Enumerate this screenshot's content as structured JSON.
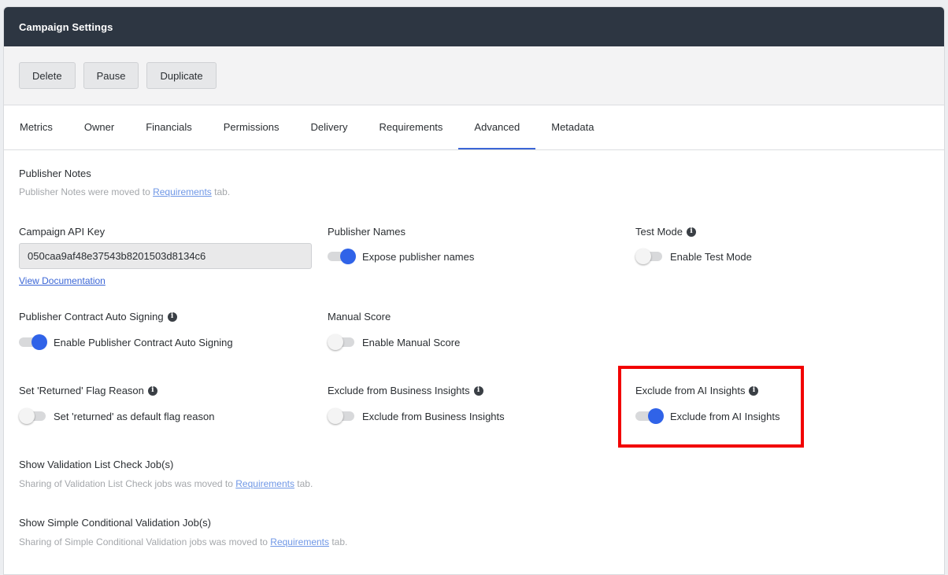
{
  "header": {
    "title": "Campaign Settings"
  },
  "actions": {
    "delete": "Delete",
    "pause": "Pause",
    "duplicate": "Duplicate"
  },
  "tabs": [
    {
      "label": "Metrics"
    },
    {
      "label": "Owner"
    },
    {
      "label": "Financials"
    },
    {
      "label": "Permissions"
    },
    {
      "label": "Delivery"
    },
    {
      "label": "Requirements"
    },
    {
      "label": "Advanced"
    },
    {
      "label": "Metadata"
    }
  ],
  "active_tab": "Advanced",
  "publisher_notes": {
    "title": "Publisher Notes",
    "text_before": "Publisher Notes were moved to ",
    "link": "Requirements",
    "text_after": " tab."
  },
  "api_key": {
    "title": "Campaign API Key",
    "value": "050caa9af48e37543b8201503d8134c6",
    "doc_link": "View Documentation"
  },
  "publisher_names": {
    "title": "Publisher Names",
    "toggle_label": "Expose publisher names",
    "on": true
  },
  "test_mode": {
    "title": "Test Mode",
    "toggle_label": "Enable Test Mode",
    "on": false
  },
  "auto_signing": {
    "title": "Publisher Contract Auto Signing",
    "toggle_label": "Enable Publisher Contract Auto Signing",
    "on": true
  },
  "manual_score": {
    "title": "Manual Score",
    "toggle_label": "Enable Manual Score",
    "on": false
  },
  "returned_flag": {
    "title": "Set 'Returned' Flag Reason",
    "toggle_label": "Set 'returned' as default flag reason",
    "on": false
  },
  "business_insights": {
    "title": "Exclude from Business Insights",
    "toggle_label": "Exclude from Business Insights",
    "on": false
  },
  "ai_insights": {
    "title": "Exclude from AI Insights",
    "toggle_label": "Exclude from AI Insights",
    "on": true
  },
  "validation_list": {
    "title": "Show Validation List Check Job(s)",
    "text_before": "Sharing of Validation List Check jobs was moved to ",
    "link": "Requirements",
    "text_after": " tab."
  },
  "conditional_validation": {
    "title": "Show Simple Conditional Validation Job(s)",
    "text_before": "Sharing of Simple Conditional Validation jobs was moved to ",
    "link": "Requirements",
    "text_after": " tab."
  },
  "colors": {
    "header_bg": "#2d3642",
    "accent": "#3063e8",
    "highlight": "#f20000"
  },
  "icons": {
    "info": "info-circle-icon"
  }
}
